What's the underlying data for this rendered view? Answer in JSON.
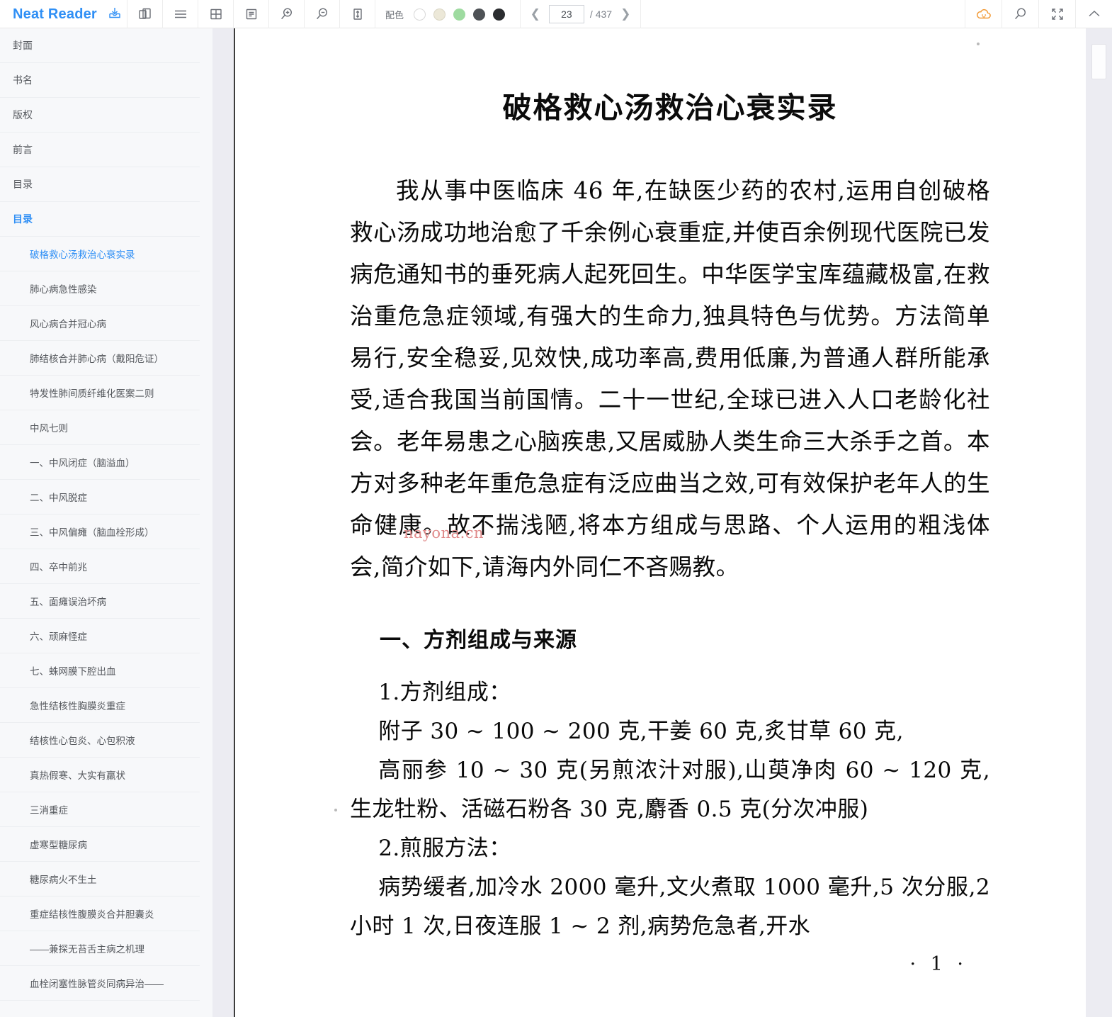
{
  "app": {
    "name": "Neat Reader",
    "brand_color": "#2f8ff5"
  },
  "toolbar": {
    "import_icon": "import-icon",
    "icons": [
      {
        "name": "duplicate-pages-icon",
        "label": "两页"
      },
      {
        "name": "list-view-icon",
        "label": "列表"
      },
      {
        "name": "grid-view-icon",
        "label": "网格"
      },
      {
        "name": "text-layout-icon",
        "label": "排版"
      },
      {
        "name": "zoom-in-icon",
        "label": "放大"
      },
      {
        "name": "zoom-out-icon",
        "label": "缩小"
      },
      {
        "name": "fit-height-icon",
        "label": "适高"
      }
    ],
    "color_scheme": {
      "label": "配色",
      "swatches": [
        "#ffffff",
        "#ece8d8",
        "#9edba0",
        "#4e5256",
        "#2b2d30"
      ]
    },
    "pager": {
      "prev_icon": "chevron-left-icon",
      "next_icon": "chevron-right-icon",
      "current_page": "23",
      "total_label": "/ 437"
    },
    "right_icons": [
      {
        "name": "cloud-sync-icon",
        "color": "#f29b38"
      },
      {
        "name": "search-icon",
        "color": "#6b6f76"
      },
      {
        "name": "fullscreen-icon",
        "color": "#6b6f76"
      },
      {
        "name": "collapse-up-icon",
        "color": "#6b6f76"
      }
    ]
  },
  "sidebar": {
    "items": [
      {
        "label": "封面",
        "level": 1,
        "active": false
      },
      {
        "label": "书名",
        "level": 1,
        "active": false
      },
      {
        "label": "版权",
        "level": 1,
        "active": false
      },
      {
        "label": "前言",
        "level": 1,
        "active": false
      },
      {
        "label": "目录",
        "level": 1,
        "active": false
      },
      {
        "label": "目录",
        "level": 1,
        "active": true
      },
      {
        "label": "破格救心汤救治心衰实录",
        "level": 2,
        "active": true
      },
      {
        "label": "肺心病急性感染",
        "level": 2,
        "active": false
      },
      {
        "label": "风心病合并冠心病",
        "level": 2,
        "active": false
      },
      {
        "label": "肺结核合并肺心病（戴阳危证）",
        "level": 2,
        "active": false
      },
      {
        "label": "特发性肺间质纤维化医案二则",
        "level": 2,
        "active": false
      },
      {
        "label": "中风七则",
        "level": 2,
        "active": false
      },
      {
        "label": "一、中风闭症（脑溢血）",
        "level": 2,
        "active": false
      },
      {
        "label": "二、中风脱症",
        "level": 2,
        "active": false
      },
      {
        "label": "三、中风偏瘫（脑血栓形成）",
        "level": 2,
        "active": false
      },
      {
        "label": "四、卒中前兆",
        "level": 2,
        "active": false
      },
      {
        "label": "五、面瘫误治坏病",
        "level": 2,
        "active": false
      },
      {
        "label": "六、顽麻怪症",
        "level": 2,
        "active": false
      },
      {
        "label": "七、蛛网膜下腔出血",
        "level": 2,
        "active": false
      },
      {
        "label": "急性结核性胸膜炎重症",
        "level": 2,
        "active": false
      },
      {
        "label": "结核性心包炎、心包积液",
        "level": 2,
        "active": false
      },
      {
        "label": "真热假寒、大实有羸状",
        "level": 2,
        "active": false
      },
      {
        "label": "三消重症",
        "level": 2,
        "active": false
      },
      {
        "label": "虚寒型糖尿病",
        "level": 2,
        "active": false
      },
      {
        "label": "糖尿病火不生土",
        "level": 2,
        "active": false
      },
      {
        "label": "重症结核性腹膜炎合并胆囊炎",
        "level": 2,
        "active": false
      },
      {
        "label": "——兼探无苔舌主病之机理",
        "level": 2,
        "active": false
      },
      {
        "label": "血栓闭塞性脉管炎同病异治——",
        "level": 2,
        "active": false
      }
    ]
  },
  "document": {
    "title": "破格救心汤救治心衰实录",
    "paragraph1": "我从事中医临床 46 年,在缺医少药的农村,运用自创破格救心汤成功地治愈了千余例心衰重症,并使百余例现代医院已发病危通知书的垂死病人起死回生。中华医学宝库蕴藏极富,在救治重危急症领域,有强大的生命力,独具特色与优势。方法简单易行,安全稳妥,见效快,成功率高,费用低廉,为普通人群所能承受,适合我国当前国情。二十一世纪,全球已进入人口老龄化社会。老年易患之心脑疾患,又居威胁人类生命三大杀手之首。本方对多种老年重危急症有泛应曲当之效,可有效保护老年人的生命健康。故不揣浅陋,将本方组成与思路、个人运用的粗浅体会,简介如下,请海内外同仁不吝赐教。",
    "heading1": "一、方剂组成与来源",
    "sub1": "1.方剂组成：",
    "sub1_line1": "附子 30 ~ 100 ~ 200 克,干姜 60 克,炙甘草 60 克,",
    "sub1_line2": "高丽参 10 ~ 30 克(另煎浓汁对服),山萸净肉 60 ~ 120 克,生龙牡粉、活磁石粉各 30 克,麝香 0.5 克(分次冲服)",
    "sub2": "2.煎服方法：",
    "sub2_line1": "病势缓者,加冷水 2000 毫升,文火煮取 1000 毫升,5 次分服,2 小时 1 次,日夜连服 1 ~ 2 剂,病势危急者,开水",
    "page_number": "· 1 ·",
    "watermark": "nayona.cn"
  }
}
